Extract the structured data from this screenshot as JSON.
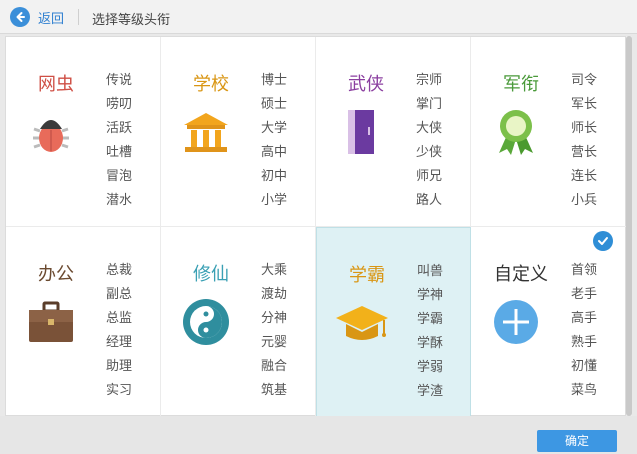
{
  "header": {
    "back_label": "返回",
    "title": "选择等级头衔"
  },
  "footer": {
    "confirm_label": "确定"
  },
  "categories": [
    {
      "title": "网虫",
      "color": "#cf4f45",
      "icon": "bug-icon",
      "items": [
        "传说",
        "唠叨",
        "活跃",
        "吐槽",
        "冒泡",
        "潜水"
      ]
    },
    {
      "title": "学校",
      "color": "#d99614",
      "icon": "school-building-icon",
      "items": [
        "博士",
        "硕士",
        "大学",
        "高中",
        "初中",
        "小学"
      ]
    },
    {
      "title": "武侠",
      "color": "#8b3fa0",
      "icon": "book-icon",
      "items": [
        "宗师",
        "掌门",
        "大侠",
        "少侠",
        "师兄",
        "路人"
      ]
    },
    {
      "title": "军衔",
      "color": "#4a9a3a",
      "icon": "medal-icon",
      "items": [
        "司令",
        "军长",
        "师长",
        "营长",
        "连长",
        "小兵"
      ]
    },
    {
      "title": "办公",
      "color": "#6b4a30",
      "icon": "briefcase-icon",
      "items": [
        "总裁",
        "副总",
        "总监",
        "经理",
        "助理",
        "实习"
      ]
    },
    {
      "title": "修仙",
      "color": "#3aa0b4",
      "icon": "yin-yang-icon",
      "items": [
        "大乘",
        "渡劫",
        "分神",
        "元婴",
        "融合",
        "筑基"
      ]
    },
    {
      "title": "学霸",
      "color": "#d99614",
      "icon": "graduation-cap-icon",
      "items": [
        "叫兽",
        "学神",
        "学霸",
        "学酥",
        "学弱",
        "学渣"
      ]
    },
    {
      "title": "自定义",
      "color": "#333333",
      "icon": "plus-circle-icon",
      "items": [
        "首领",
        "老手",
        "高手",
        "熟手",
        "初懂",
        "菜鸟"
      ]
    }
  ],
  "selected_category": "学霸",
  "colors": {
    "accent": "#3d97e3",
    "selected_bg": "#def1f4"
  }
}
